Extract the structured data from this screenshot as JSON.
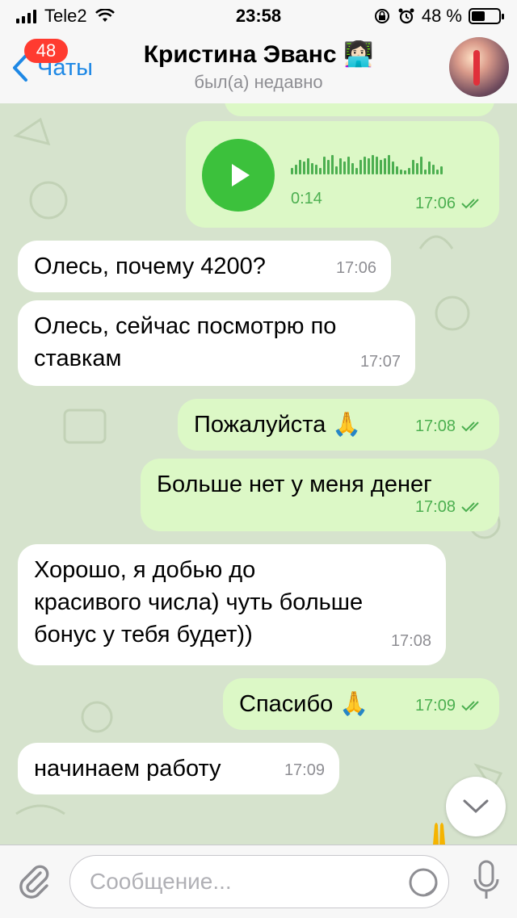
{
  "status": {
    "carrier": "Tele2",
    "time": "23:58",
    "battery": "48 %"
  },
  "header": {
    "back_label": "Чаты",
    "unread_badge": "48",
    "title": "Кристина Эванс",
    "title_emoji": "👩🏻‍💻",
    "subtitle": "был(а) недавно"
  },
  "messages": [
    {
      "id": "voice",
      "direction": "out",
      "type": "voice",
      "duration": "0:14",
      "time": "17:06"
    },
    {
      "id": "m1",
      "direction": "in",
      "text": "Олесь, почему 4200?",
      "time": "17:06"
    },
    {
      "id": "m2",
      "direction": "in",
      "line1": "Олесь, сейчас посмотрю по",
      "line2": "ставкам",
      "time": "17:07"
    },
    {
      "id": "m3",
      "direction": "out",
      "text": "Пожалуйста 🙏",
      "time": "17:08"
    },
    {
      "id": "m4",
      "direction": "out",
      "text": "Больше нет у меня денег",
      "time": "17:08"
    },
    {
      "id": "m5",
      "direction": "in",
      "line1": "Хорошо, я добью до",
      "line2": "красивого числа) чуть больше",
      "line3": "бонус у тебя будет))",
      "time": "17:08"
    },
    {
      "id": "m6",
      "direction": "out",
      "text": "Спасибо 🙏",
      "time": "17:09"
    },
    {
      "id": "m7",
      "direction": "in",
      "text": "начинаем работу",
      "time": "17:09"
    }
  ],
  "input": {
    "placeholder": "Сообщение..."
  },
  "colors": {
    "accent": "#1e88e5",
    "outgoing": "#dcf8c6",
    "incoming": "#ffffff",
    "play": "#3cc13c",
    "badge": "#ff3b30"
  }
}
